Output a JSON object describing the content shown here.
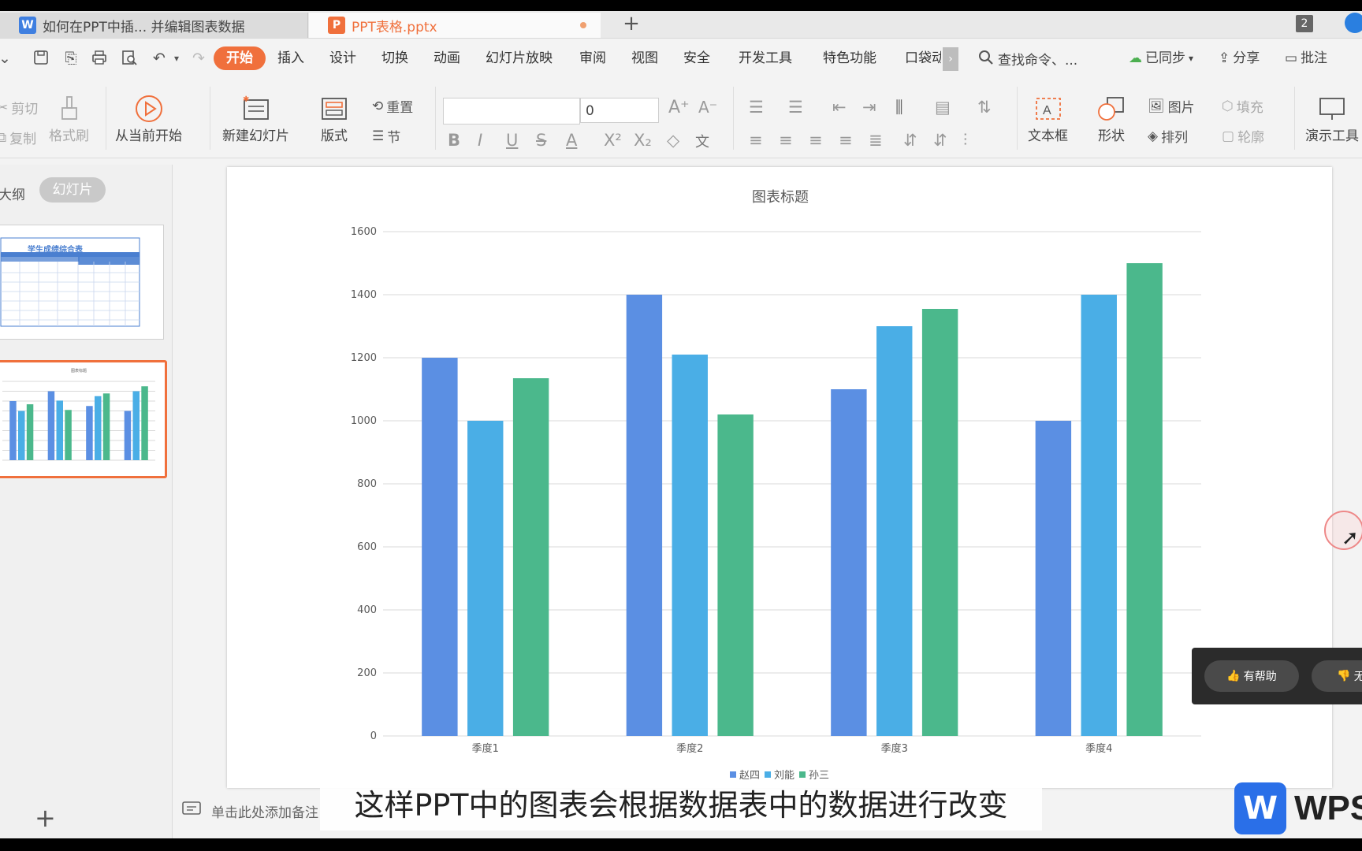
{
  "tabs": [
    {
      "title": "如何在PPT中插... 并编辑图表数据",
      "icon": "W"
    },
    {
      "title": "PPT表格.pptx",
      "icon": "P"
    }
  ],
  "window_count": "2",
  "menu": {
    "active": "开始",
    "items": [
      "插入",
      "设计",
      "切换",
      "动画",
      "幻灯片放映",
      "审阅",
      "视图",
      "安全",
      "开发工具",
      "特色功能",
      "口袋动"
    ],
    "search": "查找命令、...",
    "sync": "已同步",
    "share": "分享",
    "comment": "批注"
  },
  "ribbon": {
    "cut": "剪切",
    "copy": "复制",
    "format_painter": "格式刷",
    "play_from_current": "从当前开始",
    "new_slide": "新建幻灯片",
    "layout": "版式",
    "reset": "重置",
    "section": "节",
    "font_size": "0",
    "textbox": "文本框",
    "shape": "形状",
    "picture": "图片",
    "arrange": "排列",
    "fill": "填充",
    "outline": "轮廓",
    "presentation_tools": "演示工具"
  },
  "left_pane": {
    "outline_tab": "大纲",
    "slides_tab": "幻灯片",
    "thumb1_title": "学生成绩综合表"
  },
  "notes_placeholder": "单击此处添加备注",
  "subtitle": "这样PPT中的图表会根据数据表中的数据进行改变",
  "brand": "WPS",
  "feedback": {
    "helpful": "有帮助",
    "not_helpful": "无"
  },
  "colors": {
    "accent": "#f0703c",
    "series1": "#5b8fe3",
    "series2": "#4aaee6",
    "series3": "#4bb88c"
  },
  "chart_data": {
    "type": "bar",
    "title": "图表标题",
    "categories": [
      "季度1",
      "季度2",
      "季度3",
      "季度4"
    ],
    "series": [
      {
        "name": "赵四",
        "values": [
          1200,
          1400,
          1100,
          1000
        ]
      },
      {
        "name": "刘能",
        "values": [
          1000,
          1210,
          1300,
          1400
        ]
      },
      {
        "name": "孙三",
        "values": [
          1135,
          1020,
          1355,
          1500
        ]
      }
    ],
    "ylim": [
      0,
      1600
    ],
    "yticks": [
      "0",
      "200",
      "400",
      "600",
      "800",
      "1000",
      "1200",
      "1400",
      "1600"
    ],
    "grid": true,
    "legend": "bottom"
  }
}
